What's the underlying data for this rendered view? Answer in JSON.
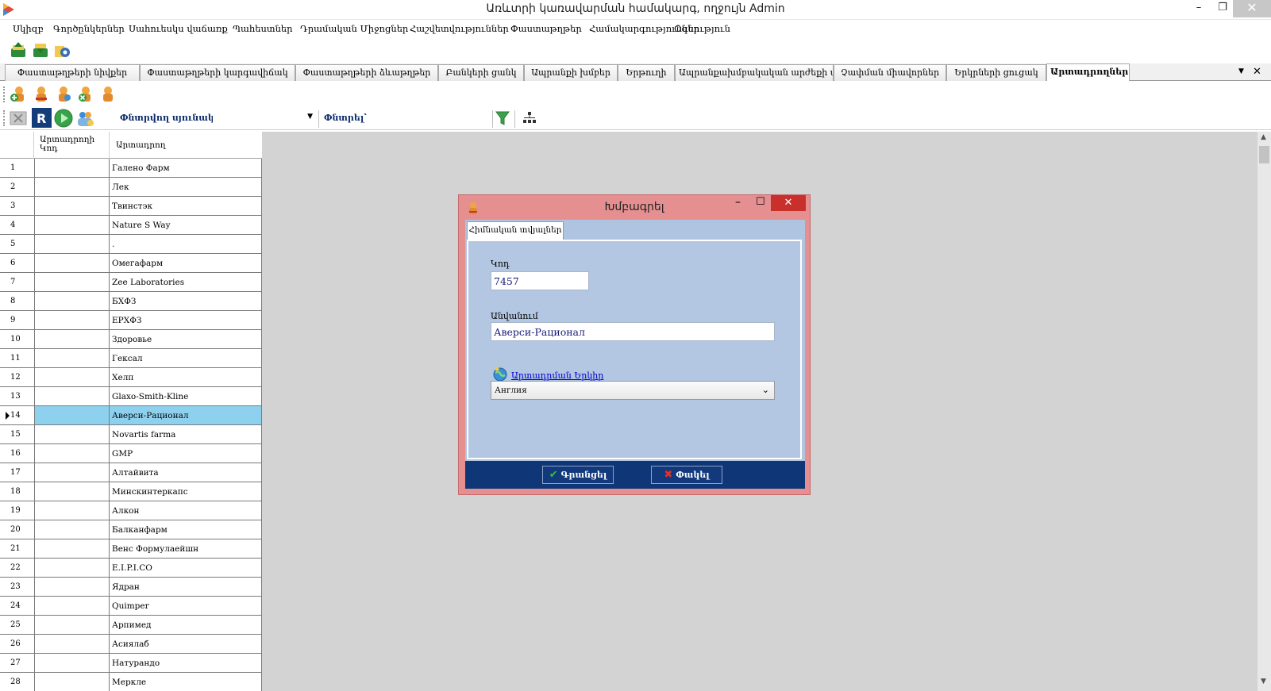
{
  "window": {
    "title": "Առևտրի կառավարման համակարգ, ողջույն Admin",
    "minimize": "–",
    "maximize": "❐",
    "close": "✕"
  },
  "menu": [
    "Սկիզբ",
    "Գործընկերներ",
    "Սահուեսկս վաճառք",
    "Պահեստներ",
    "Դրամական Միջոցներ",
    "Հաշվետվություններ",
    "Փաստաթղթեր",
    "Համակարգություններ",
    "Օգնություն"
  ],
  "tabs": [
    "Փաստաթղթերի նիվքեր",
    "Փաստաթղթերի կարգավիճակ",
    "Փաստաթղթերի ձևաթղթեր",
    "Բանկերի ցանկ",
    "Ապրանքի խմբեր",
    "Երթուղի",
    "Ապրանքախմբակական արժեքի ա...",
    "Չափման միավորներ",
    "Երկրների ցուցակ",
    "Արտադրողներ"
  ],
  "active_tab_index": 9,
  "tab_controls": {
    "dropdown": "▼",
    "close": "✕"
  },
  "toolbar3": {
    "search_column_label": "Փնտրվող սյունակ՝",
    "search_label": "Փնտրել՝",
    "combo_arrow": "▼"
  },
  "grid": {
    "columns": {
      "code": "Արտադրողի Կոդ",
      "name": "Արտադրող"
    },
    "selected_row": 14,
    "rows": [
      {
        "num": "1",
        "name": "Галено Фарм"
      },
      {
        "num": "2",
        "name": "Лек"
      },
      {
        "num": "3",
        "name": "Твинстэк"
      },
      {
        "num": "4",
        "name": "Nature S Way"
      },
      {
        "num": "5",
        "name": "."
      },
      {
        "num": "6",
        "name": "Омегафарм"
      },
      {
        "num": "7",
        "name": "Zee Laboratories"
      },
      {
        "num": "8",
        "name": "БХФЗ"
      },
      {
        "num": "9",
        "name": "ЕРХФЗ"
      },
      {
        "num": "10",
        "name": "Здоровье"
      },
      {
        "num": "11",
        "name": "Гексал"
      },
      {
        "num": "12",
        "name": "Хелп"
      },
      {
        "num": "13",
        "name": "Glaxo-Smith-Kline"
      },
      {
        "num": "14",
        "name": "Аверси-Рационал"
      },
      {
        "num": "15",
        "name": "Novartis farma"
      },
      {
        "num": "16",
        "name": "GMP"
      },
      {
        "num": "17",
        "name": "Алтайвита"
      },
      {
        "num": "18",
        "name": "Минскинтеркапс"
      },
      {
        "num": "19",
        "name": "Алкон"
      },
      {
        "num": "20",
        "name": "Балканфарм"
      },
      {
        "num": "21",
        "name": "Венс Формулаейшн"
      },
      {
        "num": "22",
        "name": "E.I.P.I.CO"
      },
      {
        "num": "23",
        "name": "Ядран"
      },
      {
        "num": "24",
        "name": "Quimper"
      },
      {
        "num": "25",
        "name": "Арпимед"
      },
      {
        "num": "26",
        "name": "Асиялаб"
      },
      {
        "num": "27",
        "name": "Натурандо"
      },
      {
        "num": "28",
        "name": "Меркле"
      }
    ]
  },
  "dialog": {
    "title": "Խմբագրել",
    "tab": "Հիմնական տվյալներ",
    "code_label": "Կոդ",
    "code_value": "7457",
    "name_label": "Անվանում",
    "name_value": "Аверси-Рационал",
    "country_link": "Արտադրման Երկիր",
    "country_value": "Англия",
    "save_button": "Գրանցել",
    "close_button": "Փակել",
    "minimize": "–",
    "maximize": "☐",
    "close": "✕"
  },
  "colors": {
    "selection": "#8ed1ee",
    "dialog_frame": "#e58f91",
    "dialog_body": "#aec4e0",
    "dialog_footer": "#0f3677",
    "workspace": "#d3d3d3"
  }
}
